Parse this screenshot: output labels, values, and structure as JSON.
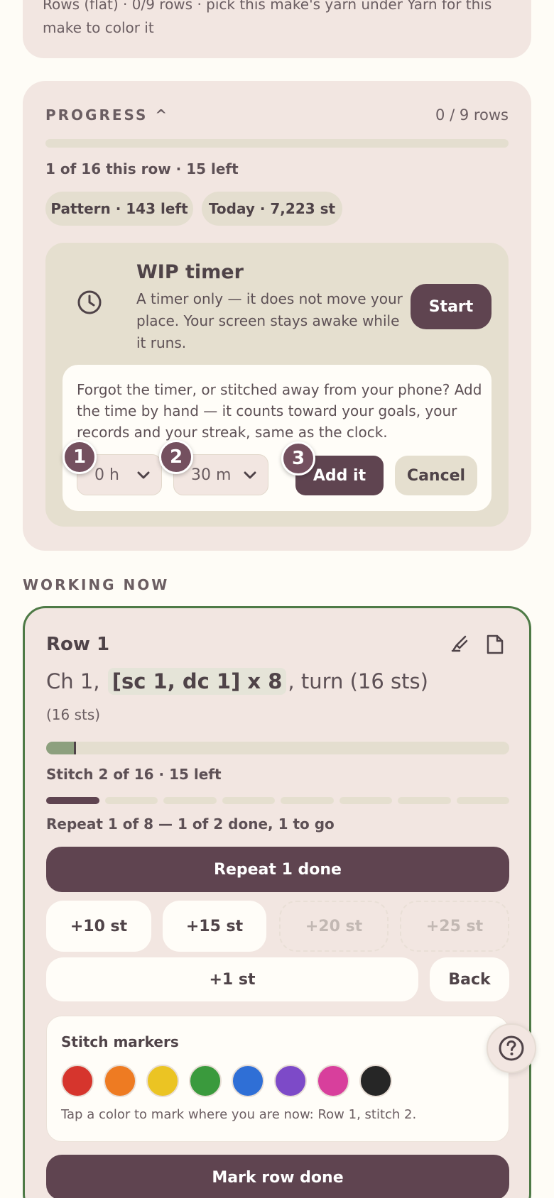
{
  "top_card": {
    "text": "Rows (flat) · 0/9 rows · pick this make's yarn under Yarn for this make to color it"
  },
  "progress": {
    "label": "PROGRESS ^",
    "rows": "0 / 9 rows",
    "progress_fraction": 0,
    "this_row": "1 of 16 this row · 15 left",
    "pills": [
      "Pattern · 143 left",
      "Today · 7,223 st"
    ],
    "timer": {
      "icon": "clock-icon",
      "title": "WIP timer",
      "description": "A timer only — it does not move your place. Your screen stays awake while it runs.",
      "start_label": "Start",
      "manual_text": "Forgot the timer, or stitched away from your phone? Add the time by hand — it counts toward your goals, your records and your streak, same as the clock.",
      "hours_value": "0 h",
      "minutes_value": "30 m",
      "add_label": "Add it",
      "cancel_label": "Cancel",
      "badges": [
        "1",
        "2",
        "3"
      ]
    }
  },
  "working": {
    "label": "WORKING NOW",
    "row_title": "Row 1",
    "instruction_prefix": "Ch 1,",
    "instruction_highlight": "[sc 1, dc 1] x 8",
    "instruction_suffix": ", turn (16 sts)",
    "stitch_count": "(16 sts)",
    "row_progress_fraction": 0.0625,
    "stitch_status": "Stitch 2 of 16 · 15 left",
    "repeat_segments_total": 8,
    "repeat_segments_done": 1,
    "repeat_status": "Repeat 1 of 8 — 1 of 2 done, 1 to go",
    "repeat_done_label": "Repeat 1 done",
    "quick_add": [
      "+10 st",
      "+15 st",
      "+20 st",
      "+25 st"
    ],
    "plus_one_label": "+1 st",
    "back_label": "Back",
    "markers": {
      "title": "Stitch markers",
      "colors": [
        "#d6352d",
        "#ee7b22",
        "#ebc423",
        "#3a9a3d",
        "#2f6fd6",
        "#7d4ac8",
        "#d83f9c",
        "#262626"
      ],
      "hint": "Tap a color to mark where you are now: Row 1, stitch 2."
    },
    "mark_row_done_label": "Mark row done"
  },
  "help_icon": "help-circle-icon",
  "colors": {
    "accent": "#5f4450",
    "card_bg": "#f2e6e1",
    "working_border": "#4e7a46"
  }
}
